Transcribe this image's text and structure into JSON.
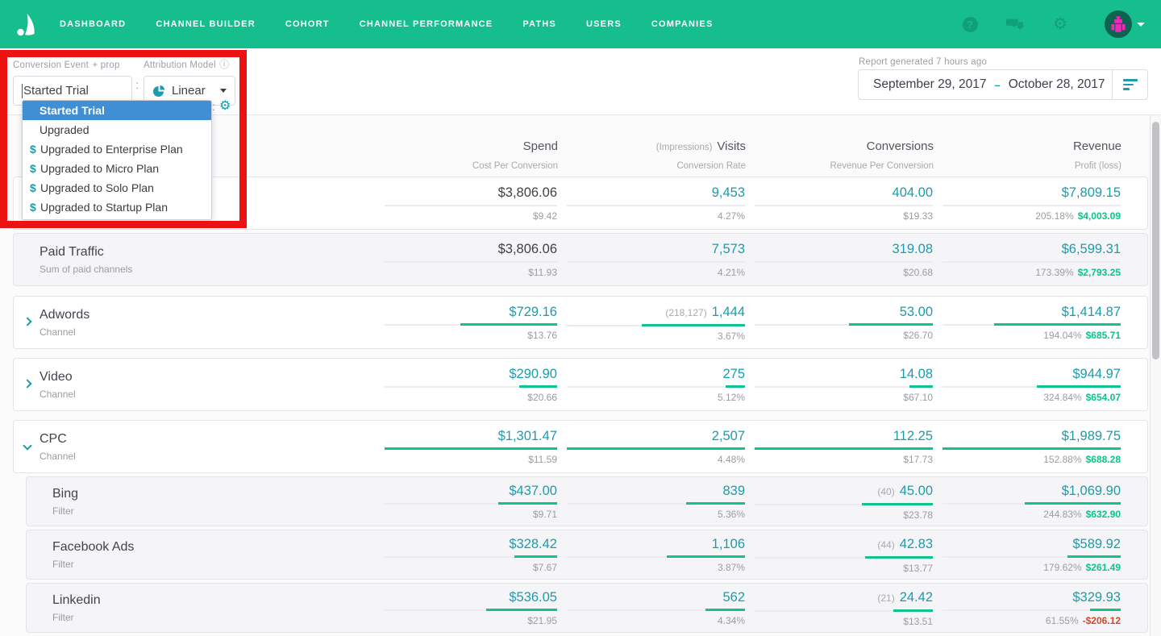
{
  "nav": {
    "items": [
      "DASHBOARD",
      "CHANNEL BUILDER",
      "COHORT",
      "CHANNEL PERFORMANCE",
      "PATHS",
      "USERS",
      "COMPANIES"
    ],
    "help_glyph": "?"
  },
  "toolbar": {
    "conversion_event_label": "Conversion Event",
    "add_prop_label": "+ prop",
    "conversion_event_value": "Started Trial",
    "separator": ":",
    "attribution_model_label": "Attribution Model",
    "attribution_model_info": "ⓘ",
    "attribution_model_value": "Linear",
    "report_generated": "Report generated 7 hours ago",
    "date_range": {
      "start": "September 29, 2017",
      "separator": "–",
      "end": "October 28, 2017"
    }
  },
  "dropdown": {
    "money_prefix": "$",
    "items": [
      {
        "label": "Started Trial",
        "selected": true,
        "money": false
      },
      {
        "label": "Upgraded",
        "selected": false,
        "money": false
      },
      {
        "label": "Upgraded to Enterprise Plan",
        "selected": false,
        "money": true
      },
      {
        "label": "Upgraded to Micro Plan",
        "selected": false,
        "money": true
      },
      {
        "label": "Upgraded to Solo Plan",
        "selected": false,
        "money": true
      },
      {
        "label": "Upgraded to Startup Plan",
        "selected": false,
        "money": true
      }
    ]
  },
  "table": {
    "columns": [
      {
        "label": "Spend",
        "sub": "Cost Per Conversion"
      },
      {
        "prefix": "(Impressions)",
        "label": "Visits",
        "sub": "Conversion Rate"
      },
      {
        "label": "Conversions",
        "sub": "Revenue Per Conversion"
      },
      {
        "label": "Revenue",
        "sub": "Profit (loss)"
      }
    ],
    "rows": [
      {
        "title": "",
        "subtitle": "",
        "style": "summary",
        "chevron": null,
        "nested": false,
        "dark_spend": true,
        "cells": [
          {
            "value": "$3,806.06",
            "sub": "$9.42",
            "bar": 0
          },
          {
            "value": "9,453",
            "sub": "4.27%",
            "bar": 0
          },
          {
            "value": "404.00",
            "sub": "$19.33",
            "bar": 0
          },
          {
            "value": "$7,809.15",
            "pct": "205.18%",
            "profit": "$4,003.09",
            "negative": false,
            "bar": 0
          }
        ]
      },
      {
        "title": "Paid Traffic",
        "subtitle": "Sum of paid channels",
        "style": "summary",
        "chevron": null,
        "nested": false,
        "dark_spend": true,
        "cells": [
          {
            "value": "$3,806.06",
            "sub": "$11.93",
            "bar": 0
          },
          {
            "value": "7,573",
            "sub": "4.21%",
            "bar": 0
          },
          {
            "value": "319.08",
            "sub": "$20.68",
            "bar": 0
          },
          {
            "value": "$6,599.31",
            "pct": "173.39%",
            "profit": "$2,793.25",
            "negative": false,
            "bar": 0
          }
        ]
      },
      {
        "title": "Adwords",
        "subtitle": "Channel",
        "style": "channel",
        "chevron": "right",
        "nested": false,
        "dark_spend": false,
        "cells": [
          {
            "value": "$729.16",
            "sub": "$13.76",
            "bar": 0.56
          },
          {
            "prefix": "(218,127)",
            "value": "1,444",
            "sub": "3.67%",
            "bar": 0.58
          },
          {
            "value": "53.00",
            "sub": "$26.70",
            "bar": 0.47
          },
          {
            "value": "$1,414.87",
            "pct": "194.04%",
            "profit": "$685.71",
            "negative": false,
            "bar": 0.71
          }
        ]
      },
      {
        "title": "Video",
        "subtitle": "Channel",
        "style": "channel",
        "chevron": "right",
        "nested": false,
        "dark_spend": false,
        "cells": [
          {
            "value": "$290.90",
            "sub": "$20.66",
            "bar": 0.22
          },
          {
            "value": "275",
            "sub": "5.12%",
            "bar": 0.11
          },
          {
            "value": "14.08",
            "sub": "$67.10",
            "bar": 0.13
          },
          {
            "value": "$944.97",
            "pct": "324.84%",
            "profit": "$654.07",
            "negative": false,
            "bar": 0.47
          }
        ]
      },
      {
        "title": "CPC",
        "subtitle": "Channel",
        "style": "channel",
        "chevron": "down",
        "nested": false,
        "dark_spend": false,
        "cells": [
          {
            "value": "$1,301.47",
            "sub": "$11.59",
            "bar": 1
          },
          {
            "value": "2,507",
            "sub": "4.48%",
            "bar": 1
          },
          {
            "value": "112.25",
            "sub": "$17.73",
            "bar": 1
          },
          {
            "value": "$1,989.75",
            "pct": "152.88%",
            "profit": "$688.28",
            "negative": false,
            "bar": 1
          }
        ]
      },
      {
        "title": "Bing",
        "subtitle": "Filter",
        "style": "filter",
        "chevron": null,
        "nested": true,
        "dark_spend": false,
        "cells": [
          {
            "value": "$437.00",
            "sub": "$9.71",
            "bar": 0.34
          },
          {
            "value": "839",
            "sub": "5.36%",
            "bar": 0.33
          },
          {
            "prefix": "(40)",
            "value": "45.00",
            "sub": "$23.78",
            "bar": 0.4
          },
          {
            "value": "$1,069.90",
            "pct": "244.83%",
            "profit": "$632.90",
            "negative": false,
            "bar": 0.54
          }
        ]
      },
      {
        "title": "Facebook Ads",
        "subtitle": "Filter",
        "style": "filter",
        "chevron": null,
        "nested": true,
        "dark_spend": false,
        "cells": [
          {
            "value": "$328.42",
            "sub": "$7.67",
            "bar": 0.25
          },
          {
            "value": "1,106",
            "sub": "3.87%",
            "bar": 0.44
          },
          {
            "prefix": "(44)",
            "value": "42.83",
            "sub": "$13.77",
            "bar": 0.38
          },
          {
            "value": "$589.92",
            "pct": "179.62%",
            "profit": "$261.49",
            "negative": false,
            "bar": 0.3
          }
        ]
      },
      {
        "title": "Linkedin",
        "subtitle": "Filter",
        "style": "filter",
        "chevron": null,
        "nested": true,
        "dark_spend": false,
        "cells": [
          {
            "value": "$536.05",
            "sub": "$21.95",
            "bar": 0.41
          },
          {
            "value": "562",
            "sub": "4.34%",
            "bar": 0.22
          },
          {
            "prefix": "(21)",
            "value": "24.42",
            "sub": "$13.51",
            "bar": 0.22
          },
          {
            "value": "$329.93",
            "pct": "61.55%",
            "profit": "-$206.12",
            "negative": true,
            "bar": 0.17
          }
        ]
      }
    ]
  },
  "colors": {
    "nav_green": "#16BE8D",
    "value_teal": "#1A9CAD",
    "profit_green": "#0BC48B",
    "loss_red": "#D0492C",
    "selected_blue": "#408FD4",
    "annotation_red": "#ED1212"
  }
}
